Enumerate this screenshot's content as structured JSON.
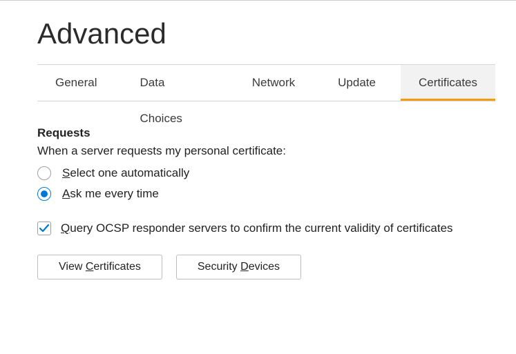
{
  "title": "Advanced",
  "tabs": [
    "General",
    "Data Choices",
    "Network",
    "Update",
    "Certificates"
  ],
  "activeTab": 4,
  "requests": {
    "heading": "Requests",
    "description": "When a server requests my personal certificate:",
    "options": [
      {
        "prefix": "S",
        "rest": "elect one automatically",
        "selected": false
      },
      {
        "prefix": "A",
        "rest": "sk me every time",
        "selected": true
      }
    ]
  },
  "ocsp": {
    "checked": true,
    "prefix": "Q",
    "rest": "uery OCSP responder servers to confirm the current validity of certificates"
  },
  "buttons": {
    "viewCertificates": {
      "before": "View ",
      "key": "C",
      "after": "ertificates"
    },
    "securityDevices": {
      "before": "Security ",
      "key": "D",
      "after": "evices"
    }
  }
}
